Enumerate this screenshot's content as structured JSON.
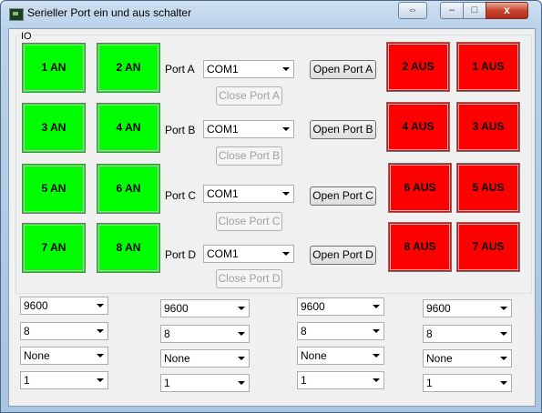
{
  "window": {
    "title": "Serieller Port ein und aus schalter",
    "controls": {
      "restore": "⇔",
      "minimize": "–",
      "maximize": "□",
      "close": "x"
    }
  },
  "io_group": {
    "label": "IO",
    "on_buttons": [
      {
        "label": "1 AN"
      },
      {
        "label": "2 AN"
      },
      {
        "label": "3 AN"
      },
      {
        "label": "4 AN"
      },
      {
        "label": "5 AN"
      },
      {
        "label": "6 AN"
      },
      {
        "label": "7 AN"
      },
      {
        "label": "8 AN"
      }
    ],
    "off_buttons": [
      {
        "label": "2 AUS"
      },
      {
        "label": "1 AUS"
      },
      {
        "label": "4 AUS"
      },
      {
        "label": "3 AUS"
      },
      {
        "label": "6 AUS"
      },
      {
        "label": "5 AUS"
      },
      {
        "label": "8 AUS"
      },
      {
        "label": "7 AUS"
      }
    ],
    "ports": [
      {
        "label": "Port A",
        "com": "COM1",
        "close": "Close Port A",
        "open": "Open Port A"
      },
      {
        "label": "Port B",
        "com": "COM1",
        "close": "Close Port B",
        "open": "Open Port B"
      },
      {
        "label": "Port C",
        "com": "COM1",
        "close": "Close Port C",
        "open": "Open Port C"
      },
      {
        "label": "Port D",
        "com": "COM1",
        "close": "Close Port D",
        "open": "Open Port D"
      }
    ]
  },
  "settings": [
    {
      "baud": "9600",
      "databits": "8",
      "parity": "None",
      "stopbits": "1"
    },
    {
      "baud": "9600",
      "databits": "8",
      "parity": "None",
      "stopbits": "1"
    },
    {
      "baud": "9600",
      "databits": "8",
      "parity": "None",
      "stopbits": "1"
    },
    {
      "baud": "9600",
      "databits": "8",
      "parity": "None",
      "stopbits": "1"
    }
  ],
  "colors": {
    "on": "#00ff00",
    "off": "#ff0000"
  }
}
